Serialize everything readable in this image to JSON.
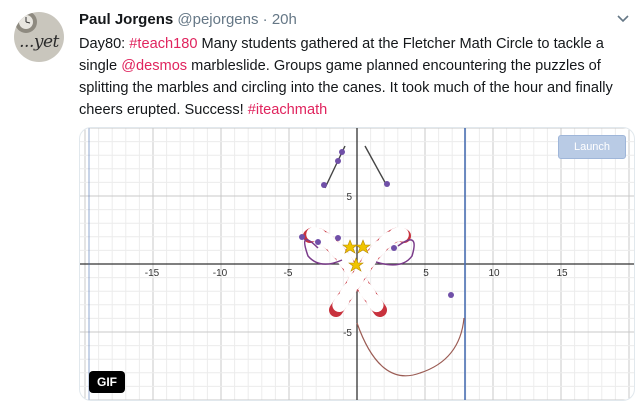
{
  "author": {
    "name": "Paul Jorgens",
    "handle": "@pejorgens",
    "separator": "·",
    "time": "20h",
    "avatar_text": "...yet"
  },
  "tweet": {
    "part1": "Day80: ",
    "hashtag1": "#teach180",
    "part2": " Many students gathered at the Fletcher Math Circle to tackle a single ",
    "mention": "@desmos",
    "part3": " marbleslide. Groups game planned encountering the puzzles of splitting the marbles and circling into the canes. It took much of the hour and finally cheers erupted. Success! ",
    "hashtag2": "#iteachmath"
  },
  "media": {
    "launch_label": "Launch",
    "gif_badge": "GIF",
    "x_ticks": [
      "-15",
      "-10",
      "-5",
      "5",
      "10",
      "15"
    ],
    "y_ticks": [
      "5",
      "-5"
    ]
  },
  "colors": {
    "hashtag": "#e0245e",
    "cane_red": "#c8323d",
    "curve": "#9b5c54",
    "marble": "#7050a8",
    "star": "#f0c400",
    "axis_line": "#4a6fb3"
  },
  "icons": {
    "menu": "chevron-down",
    "cursor": "mouse-pointer"
  }
}
